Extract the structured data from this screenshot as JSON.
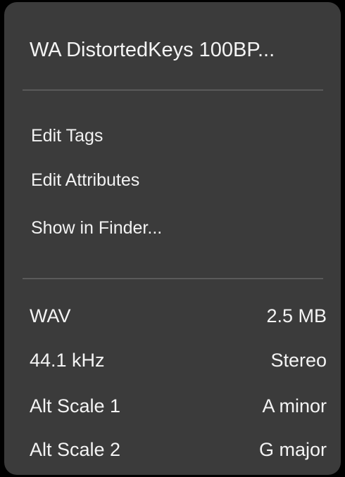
{
  "menu": {
    "title": "WA DistortedKeys 100BP...",
    "actions": [
      {
        "label": "Edit Tags"
      },
      {
        "label": "Edit Attributes"
      },
      {
        "label": "Show in Finder..."
      }
    ],
    "info": [
      {
        "left": "WAV",
        "right": "2.5 MB"
      },
      {
        "left": "44.1 kHz",
        "right": "Stereo"
      },
      {
        "left": "Alt Scale 1",
        "right": "A minor"
      },
      {
        "left": "Alt Scale 2",
        "right": "G major"
      }
    ]
  }
}
